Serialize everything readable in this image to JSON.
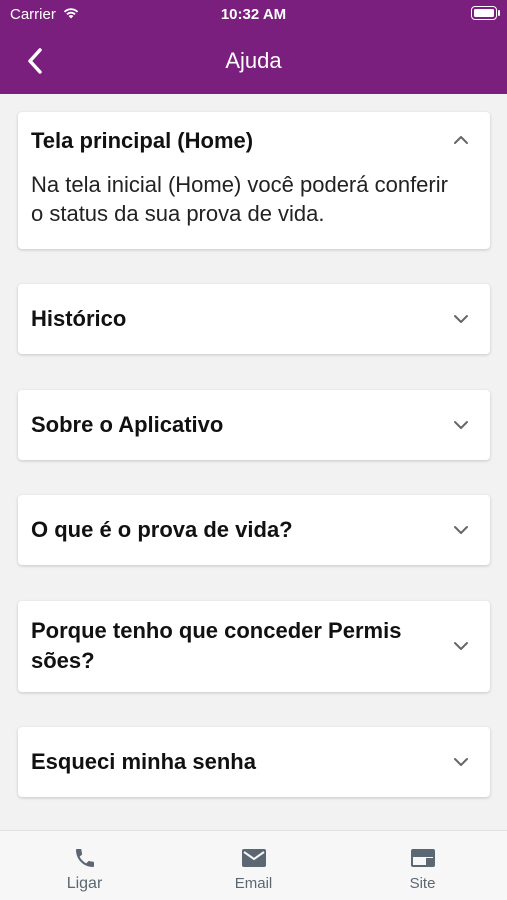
{
  "status_bar": {
    "carrier": "Carrier",
    "time": "10:32 AM"
  },
  "nav": {
    "title": "Ajuda",
    "back_icon": "chevron-left-icon"
  },
  "faq": [
    {
      "title": "Tela principal (Home)",
      "expanded": true,
      "body": "Na tela inicial (Home) você poderá conferir o status da sua prova de vida."
    },
    {
      "title": "Histórico",
      "expanded": false
    },
    {
      "title": "Sobre o Aplicativo",
      "expanded": false
    },
    {
      "title": "O que é o prova de vida?",
      "expanded": false
    },
    {
      "title": "Porque tenho que conceder Permis sões?",
      "expanded": false
    },
    {
      "title": "Esqueci minha senha",
      "expanded": false
    }
  ],
  "tabs": [
    {
      "label": "Ligar",
      "icon": "phone-icon"
    },
    {
      "label": "Email",
      "icon": "mail-icon"
    },
    {
      "label": "Site",
      "icon": "web-icon"
    }
  ],
  "colors": {
    "header": "#7a1f7d",
    "tab_icon": "#5b6773",
    "background": "#f2f2f2"
  }
}
